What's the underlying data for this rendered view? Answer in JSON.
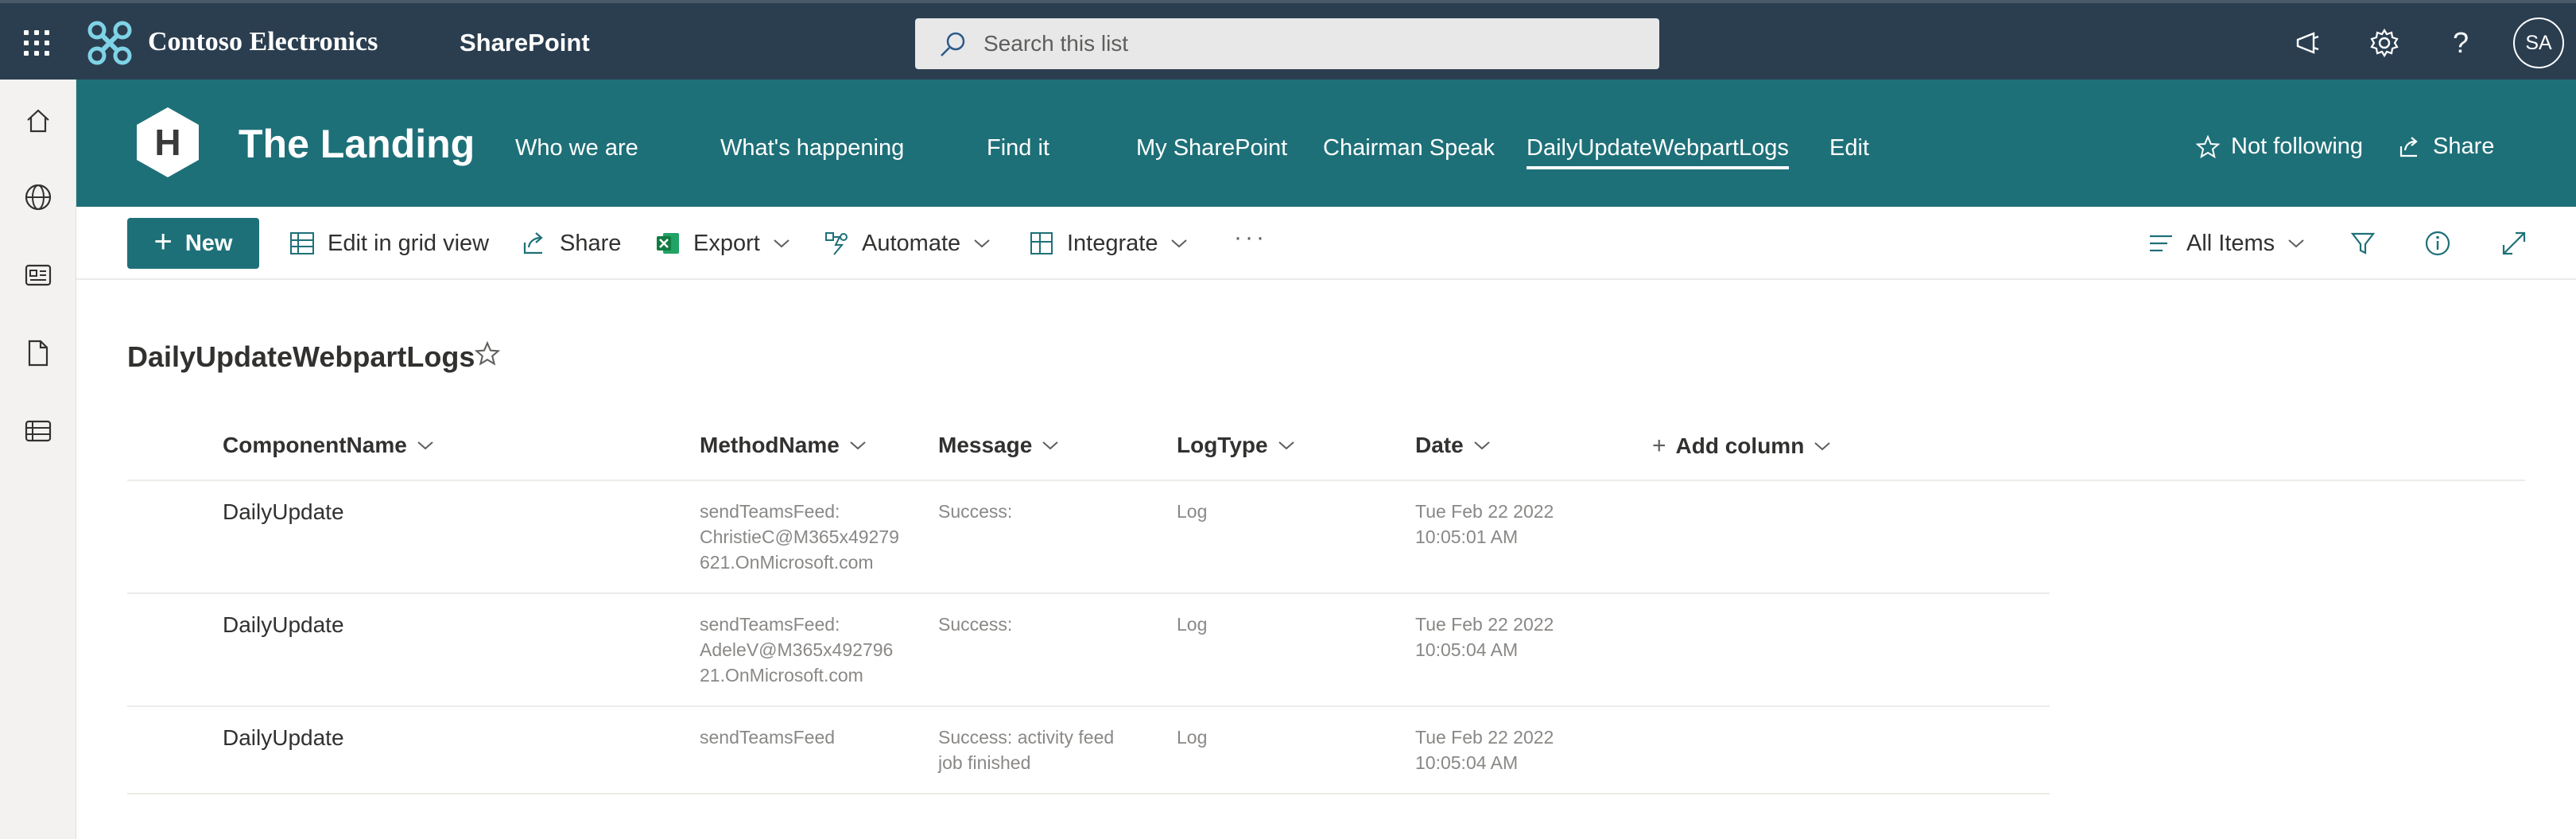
{
  "suite": {
    "brand": "Contoso Electronics",
    "app": "SharePoint",
    "search_placeholder": "Search this list",
    "avatar_initials": "SA",
    "brand_color": "#2b3e50"
  },
  "site": {
    "title": "The Landing",
    "logo_letter": "H",
    "header_color": "#1e7078",
    "nav": [
      {
        "label": "Who we are"
      },
      {
        "label": "What's happening"
      },
      {
        "label": "Find it"
      },
      {
        "label": "My SharePoint"
      },
      {
        "label": "Chairman Speak"
      },
      {
        "label": "DailyUpdateWebpartLogs",
        "active": true
      },
      {
        "label": "Edit"
      }
    ],
    "follow_label": "Not following",
    "share_label": "Share"
  },
  "command_bar": {
    "new": "New",
    "edit_grid": "Edit in grid view",
    "share": "Share",
    "export": "Export",
    "automate": "Automate",
    "integrate": "Integrate",
    "more": "···",
    "view": "All Items"
  },
  "list": {
    "title": "DailyUpdateWebpartLogs",
    "columns": {
      "component": "ComponentName",
      "method": "MethodName",
      "message": "Message",
      "logtype": "LogType",
      "date": "Date",
      "add": "Add column"
    },
    "rows": [
      {
        "component": "DailyUpdate",
        "method": [
          "sendTeamsFeed:",
          "ChristieC@M365x49279",
          "621.OnMicrosoft.com"
        ],
        "message": [
          "Success:"
        ],
        "logtype": "Log",
        "date": [
          "Tue Feb 22 2022",
          "10:05:01 AM"
        ]
      },
      {
        "component": "DailyUpdate",
        "method": [
          "sendTeamsFeed:",
          "AdeleV@M365x492796",
          "21.OnMicrosoft.com"
        ],
        "message": [
          "Success:"
        ],
        "logtype": "Log",
        "date": [
          "Tue Feb 22 2022",
          "10:05:04 AM"
        ]
      },
      {
        "component": "DailyUpdate",
        "method": [
          "sendTeamsFeed"
        ],
        "message": [
          "Success: activity feed",
          "job finished"
        ],
        "logtype": "Log",
        "date": [
          "Tue Feb 22 2022",
          "10:05:04 AM"
        ]
      }
    ]
  }
}
